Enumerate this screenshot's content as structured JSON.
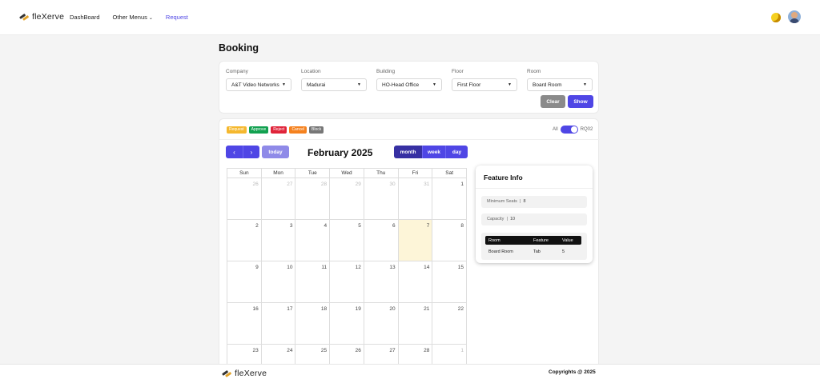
{
  "app": {
    "logo_text": "fleXerve"
  },
  "nav": {
    "items": [
      {
        "label": "DashBoard"
      },
      {
        "label": "Other Menus",
        "chevron": "chevron-down-icon"
      },
      {
        "label": "Request",
        "active": true
      }
    ]
  },
  "page": {
    "title": "Booking"
  },
  "filters": {
    "company": {
      "label": "Company",
      "value": "A&T Video Networks"
    },
    "location": {
      "label": "Location",
      "value": "Madurai"
    },
    "building": {
      "label": "Building",
      "value": "HO-Head Office"
    },
    "floor": {
      "label": "Floor",
      "value": "First Floor"
    },
    "room": {
      "label": "Room",
      "value": "Board Room"
    },
    "clear_label": "Clear",
    "show_label": "Show"
  },
  "legend": [
    {
      "label": "Request",
      "color": "#f5b82e"
    },
    {
      "label": "Approve",
      "color": "#12a150"
    },
    {
      "label": "Reject",
      "color": "#e0243a"
    },
    {
      "label": "Cancel",
      "color": "#f5821f"
    },
    {
      "label": "Block",
      "color": "#777777"
    }
  ],
  "toggle": {
    "left_label": "All",
    "right_label": "RQ02",
    "on": true
  },
  "calendar": {
    "today_label": "today",
    "month_title": "February 2025",
    "views": [
      "month",
      "week",
      "day"
    ],
    "active_view": "month",
    "weekdays": [
      "Sun",
      "Mon",
      "Tue",
      "Wed",
      "Thu",
      "Fri",
      "Sat"
    ],
    "weeks": [
      [
        {
          "d": "26",
          "o": true
        },
        {
          "d": "27",
          "o": true
        },
        {
          "d": "28",
          "o": true
        },
        {
          "d": "29",
          "o": true
        },
        {
          "d": "30",
          "o": true
        },
        {
          "d": "31",
          "o": true
        },
        {
          "d": "1"
        }
      ],
      [
        {
          "d": "2"
        },
        {
          "d": "3"
        },
        {
          "d": "4"
        },
        {
          "d": "5"
        },
        {
          "d": "6"
        },
        {
          "d": "7",
          "t": true
        },
        {
          "d": "8"
        }
      ],
      [
        {
          "d": "9"
        },
        {
          "d": "10"
        },
        {
          "d": "11"
        },
        {
          "d": "12"
        },
        {
          "d": "13"
        },
        {
          "d": "14"
        },
        {
          "d": "15"
        }
      ],
      [
        {
          "d": "16"
        },
        {
          "d": "17"
        },
        {
          "d": "18"
        },
        {
          "d": "19"
        },
        {
          "d": "20"
        },
        {
          "d": "21"
        },
        {
          "d": "22"
        }
      ],
      [
        {
          "d": "23"
        },
        {
          "d": "24"
        },
        {
          "d": "25"
        },
        {
          "d": "26"
        },
        {
          "d": "27"
        },
        {
          "d": "28"
        },
        {
          "d": "1",
          "o": true
        }
      ]
    ]
  },
  "feature_info": {
    "title": "Feature Info",
    "min_seats_label": "Minimum Seats",
    "min_seats_value": "8",
    "capacity_label": "Capacity",
    "capacity_value": "10",
    "table_headers": [
      "Room",
      "Feature",
      "Value"
    ],
    "table_rows": [
      [
        "Board Room",
        "Tab",
        "5"
      ]
    ]
  },
  "footer": {
    "logo_text": "fleXerve",
    "copyright": "Copyrights @ 2025"
  }
}
